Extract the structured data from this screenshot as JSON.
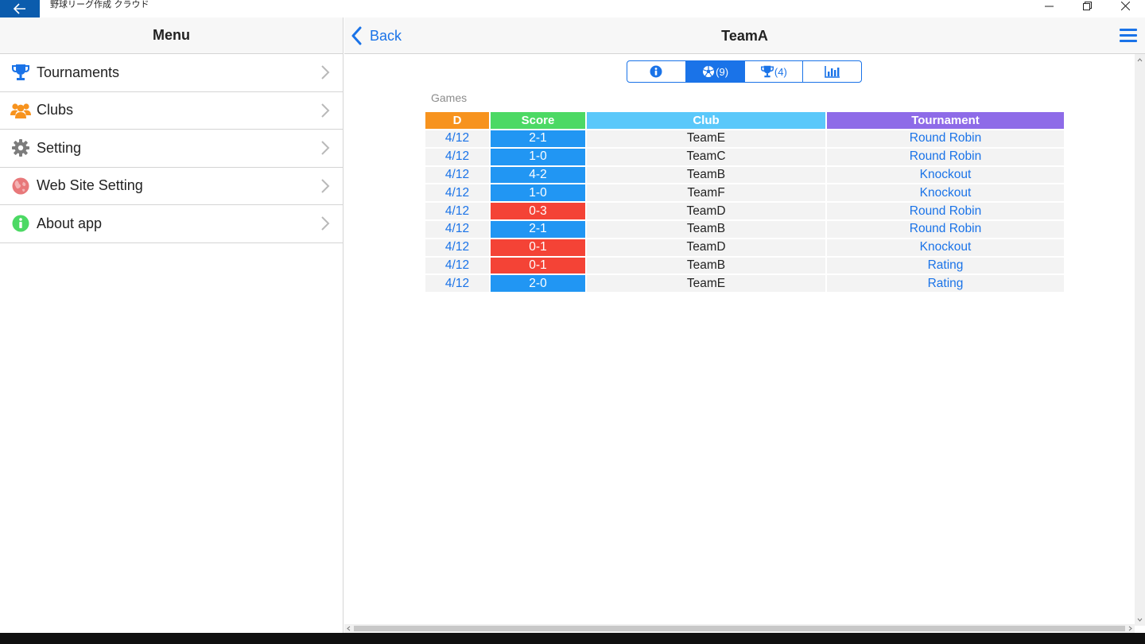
{
  "window": {
    "title": "野球リーグ作成 クラウド"
  },
  "left_pane": {
    "title": "Menu",
    "items": [
      {
        "label": "Tournaments",
        "icon": "trophy-icon",
        "color": "#1a73e8"
      },
      {
        "label": "Clubs",
        "icon": "users-icon",
        "color": "#f7931e"
      },
      {
        "label": "Setting",
        "icon": "gear-icon",
        "color": "#7d7d7d"
      },
      {
        "label": "Web Site Setting",
        "icon": "globe-icon",
        "color": "#e8787a"
      },
      {
        "label": "About app",
        "icon": "info-icon",
        "color": "#4cd964"
      }
    ]
  },
  "nav": {
    "back_label": "Back",
    "title": "TeamA"
  },
  "segments": [
    {
      "icon": "info-icon",
      "count": "",
      "active": false
    },
    {
      "icon": "soccer-ball-icon",
      "count": "(9)",
      "active": true
    },
    {
      "icon": "trophy-icon",
      "count": "(4)",
      "active": false
    },
    {
      "icon": "bar-chart-icon",
      "count": "",
      "active": false
    }
  ],
  "games": {
    "section_label": "Games",
    "headers": {
      "date": "D",
      "score": "Score",
      "club": "Club",
      "tournament": "Tournament"
    },
    "rows": [
      {
        "date": "4/12",
        "score": "2-1",
        "result": "win",
        "club": "TeamE",
        "tournament": "Round Robin"
      },
      {
        "date": "4/12",
        "score": "1-0",
        "result": "win",
        "club": "TeamC",
        "tournament": "Round Robin"
      },
      {
        "date": "4/12",
        "score": "4-2",
        "result": "win",
        "club": "TeamB",
        "tournament": "Knockout"
      },
      {
        "date": "4/12",
        "score": "1-0",
        "result": "win",
        "club": "TeamF",
        "tournament": "Knockout"
      },
      {
        "date": "4/12",
        "score": "0-3",
        "result": "loss",
        "club": "TeamD",
        "tournament": "Round Robin"
      },
      {
        "date": "4/12",
        "score": "2-1",
        "result": "win",
        "club": "TeamB",
        "tournament": "Round Robin"
      },
      {
        "date": "4/12",
        "score": "0-1",
        "result": "loss",
        "club": "TeamD",
        "tournament": "Knockout"
      },
      {
        "date": "4/12",
        "score": "0-1",
        "result": "loss",
        "club": "TeamB",
        "tournament": "Rating"
      },
      {
        "date": "4/12",
        "score": "2-0",
        "result": "win",
        "club": "TeamE",
        "tournament": "Rating"
      }
    ]
  },
  "colors": {
    "accent": "#1a73e8",
    "win": "#2196f3",
    "loss": "#f44336",
    "header_date": "#f7931e",
    "header_score": "#4cd964",
    "header_club": "#5ac8fa",
    "header_tournament": "#8e6be8"
  }
}
